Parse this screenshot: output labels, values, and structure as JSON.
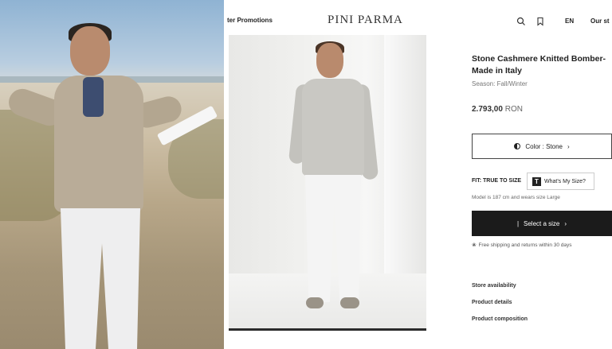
{
  "video": {
    "scene": "beach-presenter"
  },
  "header": {
    "nav_link": "ter Promotions",
    "logo": "PINI PARMA",
    "language": "EN",
    "stores_link": "Our st",
    "icons": [
      "search-icon",
      "bookmark-icon"
    ]
  },
  "product": {
    "title_line1": "Stone Cashmere Knitted Bomber-",
    "title_line2": "Made in Italy",
    "season": "Season: Fall/Winter",
    "price_amount": "2.793,00",
    "price_currency": "RON",
    "color_button": "Color : Stone",
    "fit_label": "FIT: TRUE TO SIZE",
    "size_guide_button": "What's My Size?",
    "size_guide_icon_letter": "T",
    "model_note": "Model is 187 cm and wears size Large",
    "select_size_button": "Select a size",
    "shipping_note": "Free shipping and returns within 30 days",
    "accordion": [
      "Store availability",
      "Product details",
      "Product composition"
    ]
  }
}
